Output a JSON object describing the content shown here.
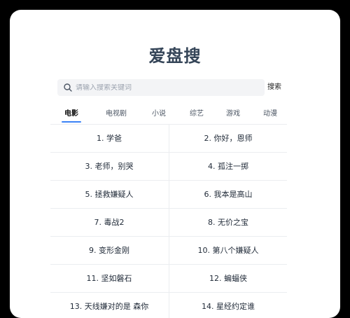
{
  "app": {
    "title": "爱盘搜"
  },
  "search": {
    "placeholder": "请输入搜索关键词",
    "value": "",
    "button_label": "搜索"
  },
  "tabs": [
    {
      "label": "电影",
      "active": true
    },
    {
      "label": "电视剧",
      "active": false
    },
    {
      "label": "小说",
      "active": false
    },
    {
      "label": "综艺",
      "active": false
    },
    {
      "label": "游戏",
      "active": false
    },
    {
      "label": "动漫",
      "active": false
    }
  ],
  "items": [
    "1. 学爸",
    "2. 你好，恩师",
    "3. 老师，别哭",
    "4. 孤注一掷",
    "5. 拯救嫌疑人",
    "6. 我本是高山",
    "7. 毒战2",
    "8. 无价之宝",
    "9. 变形金刚",
    "10. 第八个嫌疑人",
    "11. 坚如磐石",
    "12. 蝙蝠侠",
    "13. 天线嫌对的是 森你",
    "14. 星经约定谁"
  ],
  "colors": {
    "accent": "#3b82f6",
    "title": "#354558",
    "background": "#000000"
  }
}
